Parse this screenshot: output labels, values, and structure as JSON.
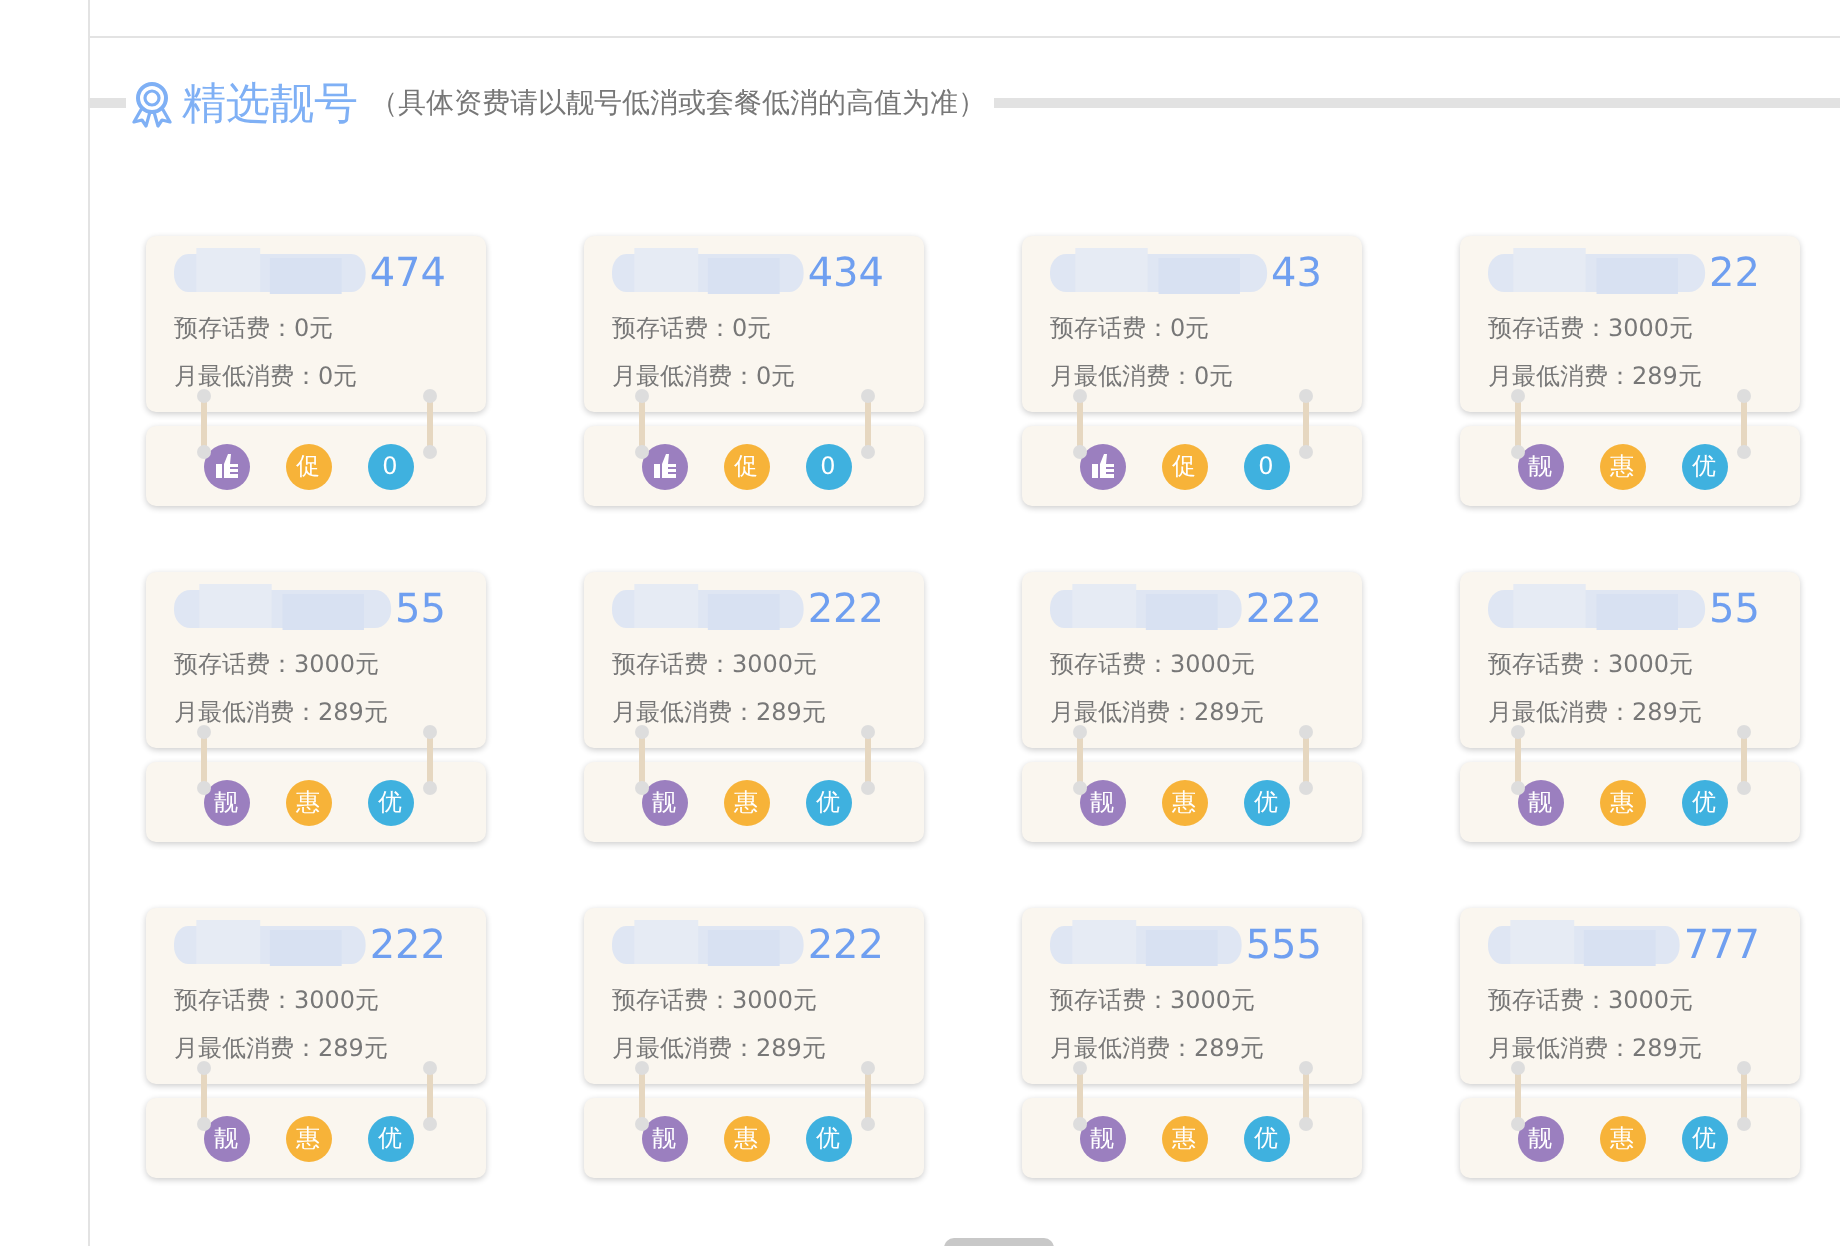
{
  "section": {
    "title": "精选靓号",
    "note": "（具体资费请以靓号低消或套餐低消的高值为准）"
  },
  "numbers": [
    {
      "number_tail": "474",
      "prepaid": "预存话费：0元",
      "min_spend": "月最低消费：0元",
      "badges": [
        {
          "kind": "icon",
          "color": "#9b7fbf"
        },
        {
          "kind": "text",
          "label": "促",
          "color": "#f7b339"
        },
        {
          "kind": "text",
          "label": "0",
          "color": "#3fb1df"
        }
      ]
    },
    {
      "number_tail": "434",
      "prepaid": "预存话费：0元",
      "min_spend": "月最低消费：0元",
      "badges": [
        {
          "kind": "icon",
          "color": "#9b7fbf"
        },
        {
          "kind": "text",
          "label": "促",
          "color": "#f7b339"
        },
        {
          "kind": "text",
          "label": "0",
          "color": "#3fb1df"
        }
      ]
    },
    {
      "number_tail": "43",
      "prepaid": "预存话费：0元",
      "min_spend": "月最低消费：0元",
      "badges": [
        {
          "kind": "icon",
          "color": "#9b7fbf"
        },
        {
          "kind": "text",
          "label": "促",
          "color": "#f7b339"
        },
        {
          "kind": "text",
          "label": "0",
          "color": "#3fb1df"
        }
      ]
    },
    {
      "number_tail": "22",
      "prepaid": "预存话费：3000元",
      "min_spend": "月最低消费：289元",
      "badges": [
        {
          "kind": "text",
          "label": "靓",
          "color": "#9b7fbf"
        },
        {
          "kind": "text",
          "label": "惠",
          "color": "#f7b339"
        },
        {
          "kind": "text",
          "label": "优",
          "color": "#3fb1df"
        }
      ]
    },
    {
      "number_tail": "55",
      "prepaid": "预存话费：3000元",
      "min_spend": "月最低消费：289元",
      "badges": [
        {
          "kind": "text",
          "label": "靓",
          "color": "#9b7fbf"
        },
        {
          "kind": "text",
          "label": "惠",
          "color": "#f7b339"
        },
        {
          "kind": "text",
          "label": "优",
          "color": "#3fb1df"
        }
      ]
    },
    {
      "number_tail": "222",
      "prepaid": "预存话费：3000元",
      "min_spend": "月最低消费：289元",
      "badges": [
        {
          "kind": "text",
          "label": "靓",
          "color": "#9b7fbf"
        },
        {
          "kind": "text",
          "label": "惠",
          "color": "#f7b339"
        },
        {
          "kind": "text",
          "label": "优",
          "color": "#3fb1df"
        }
      ]
    },
    {
      "number_tail": "222",
      "prepaid": "预存话费：3000元",
      "min_spend": "月最低消费：289元",
      "badges": [
        {
          "kind": "text",
          "label": "靓",
          "color": "#9b7fbf"
        },
        {
          "kind": "text",
          "label": "惠",
          "color": "#f7b339"
        },
        {
          "kind": "text",
          "label": "优",
          "color": "#3fb1df"
        }
      ]
    },
    {
      "number_tail": "55",
      "prepaid": "预存话费：3000元",
      "min_spend": "月最低消费：289元",
      "badges": [
        {
          "kind": "text",
          "label": "靓",
          "color": "#9b7fbf"
        },
        {
          "kind": "text",
          "label": "惠",
          "color": "#f7b339"
        },
        {
          "kind": "text",
          "label": "优",
          "color": "#3fb1df"
        }
      ]
    },
    {
      "number_tail": "222",
      "prepaid": "预存话费：3000元",
      "min_spend": "月最低消费：289元",
      "badges": [
        {
          "kind": "text",
          "label": "靓",
          "color": "#9b7fbf"
        },
        {
          "kind": "text",
          "label": "惠",
          "color": "#f7b339"
        },
        {
          "kind": "text",
          "label": "优",
          "color": "#3fb1df"
        }
      ]
    },
    {
      "number_tail": "222",
      "prepaid": "预存话费：3000元",
      "min_spend": "月最低消费：289元",
      "badges": [
        {
          "kind": "text",
          "label": "靓",
          "color": "#9b7fbf"
        },
        {
          "kind": "text",
          "label": "惠",
          "color": "#f7b339"
        },
        {
          "kind": "text",
          "label": "优",
          "color": "#3fb1df"
        }
      ]
    },
    {
      "number_tail": "555",
      "prepaid": "预存话费：3000元",
      "min_spend": "月最低消费：289元",
      "badges": [
        {
          "kind": "text",
          "label": "靓",
          "color": "#9b7fbf"
        },
        {
          "kind": "text",
          "label": "惠",
          "color": "#f7b339"
        },
        {
          "kind": "text",
          "label": "优",
          "color": "#3fb1df"
        }
      ]
    },
    {
      "number_tail": "777",
      "prepaid": "预存话费：3000元",
      "min_spend": "月最低消费：289元",
      "badges": [
        {
          "kind": "text",
          "label": "靓",
          "color": "#9b7fbf"
        },
        {
          "kind": "text",
          "label": "惠",
          "color": "#f7b339"
        },
        {
          "kind": "text",
          "label": "优",
          "color": "#3fb1df"
        }
      ]
    }
  ]
}
